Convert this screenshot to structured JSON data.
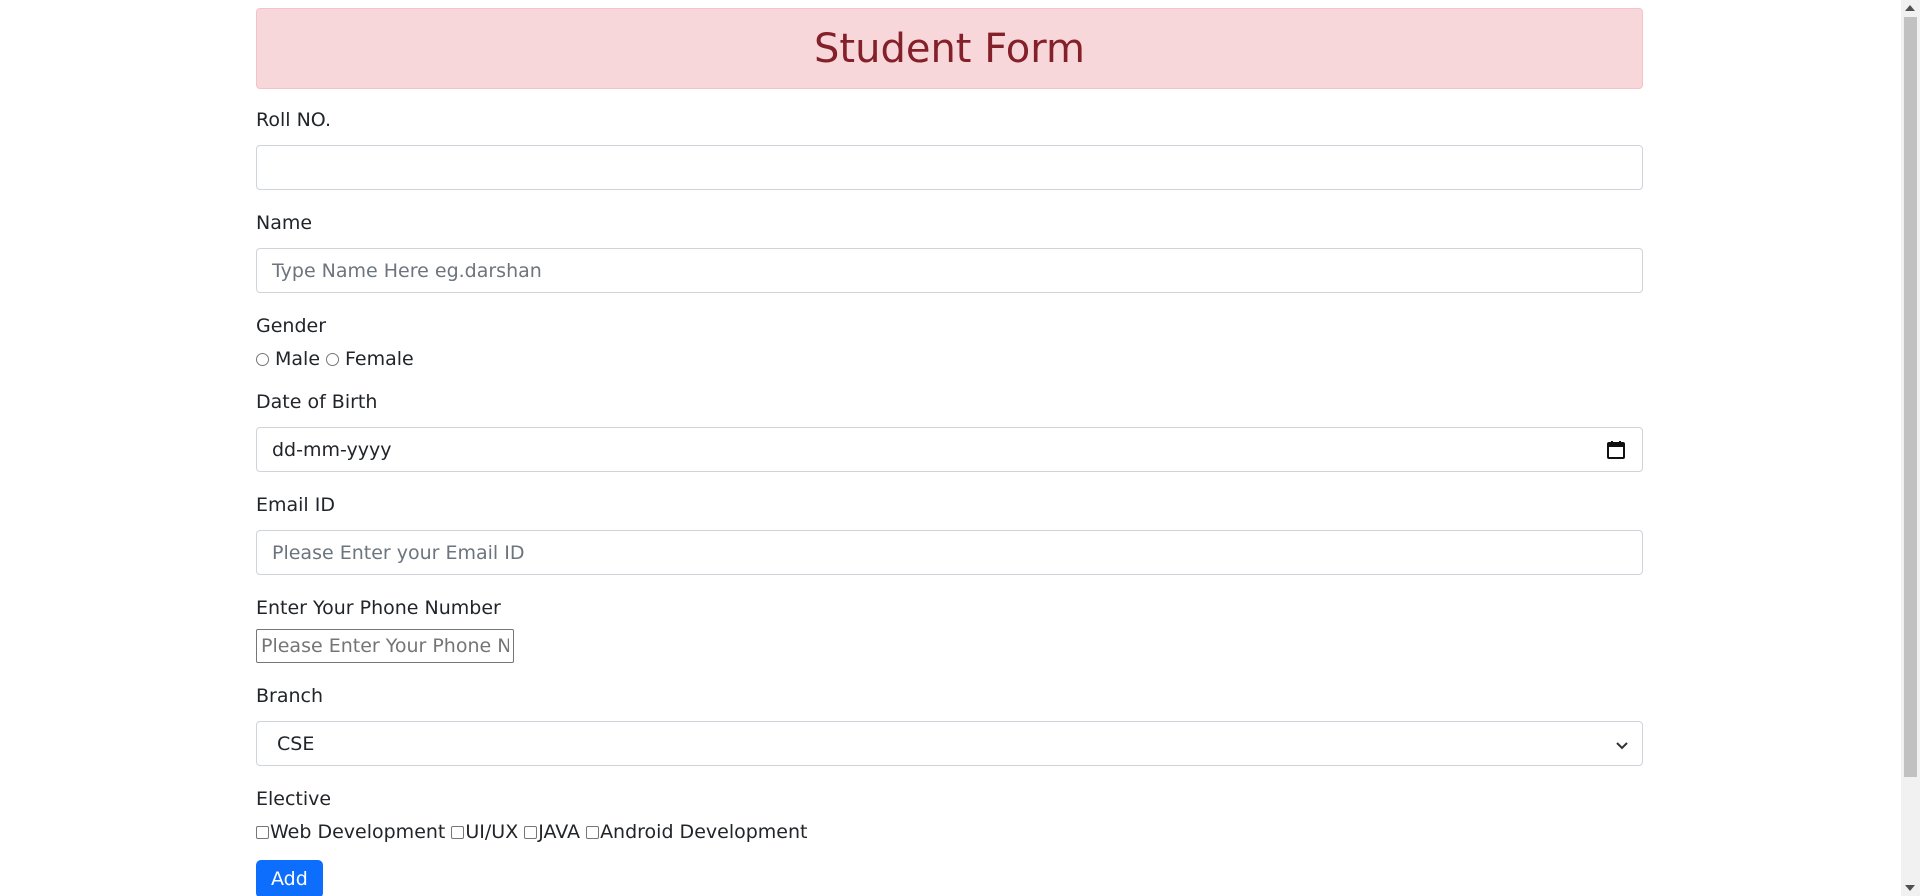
{
  "banner": {
    "title": "Student Form"
  },
  "form": {
    "roll": {
      "label": "Roll NO.",
      "value": ""
    },
    "name": {
      "label": "Name",
      "placeholder": "Type Name Here eg.darshan"
    },
    "gender": {
      "label": "Gender",
      "options": [
        "Male",
        "Female"
      ]
    },
    "dob": {
      "label": "Date of Birth",
      "placeholder": "dd-mm-yyyy"
    },
    "email": {
      "label": "Email ID",
      "placeholder": "Please Enter your Email ID"
    },
    "phone": {
      "label": "Enter Your Phone Number",
      "placeholder": "Please Enter Your Phone Number"
    },
    "branch": {
      "label": "Branch",
      "selected": "CSE"
    },
    "elective": {
      "label": "Elective",
      "options": [
        "Web Development",
        "UI/UX",
        "JAVA",
        "Android Development"
      ]
    },
    "submit_label": "Add"
  },
  "icons": {
    "calendar": "calendar-icon",
    "select": "chevron-down-icon"
  },
  "colors": {
    "banner_bg": "#f8d7da",
    "banner_text": "#842029",
    "button_bg": "#0d6efd"
  }
}
